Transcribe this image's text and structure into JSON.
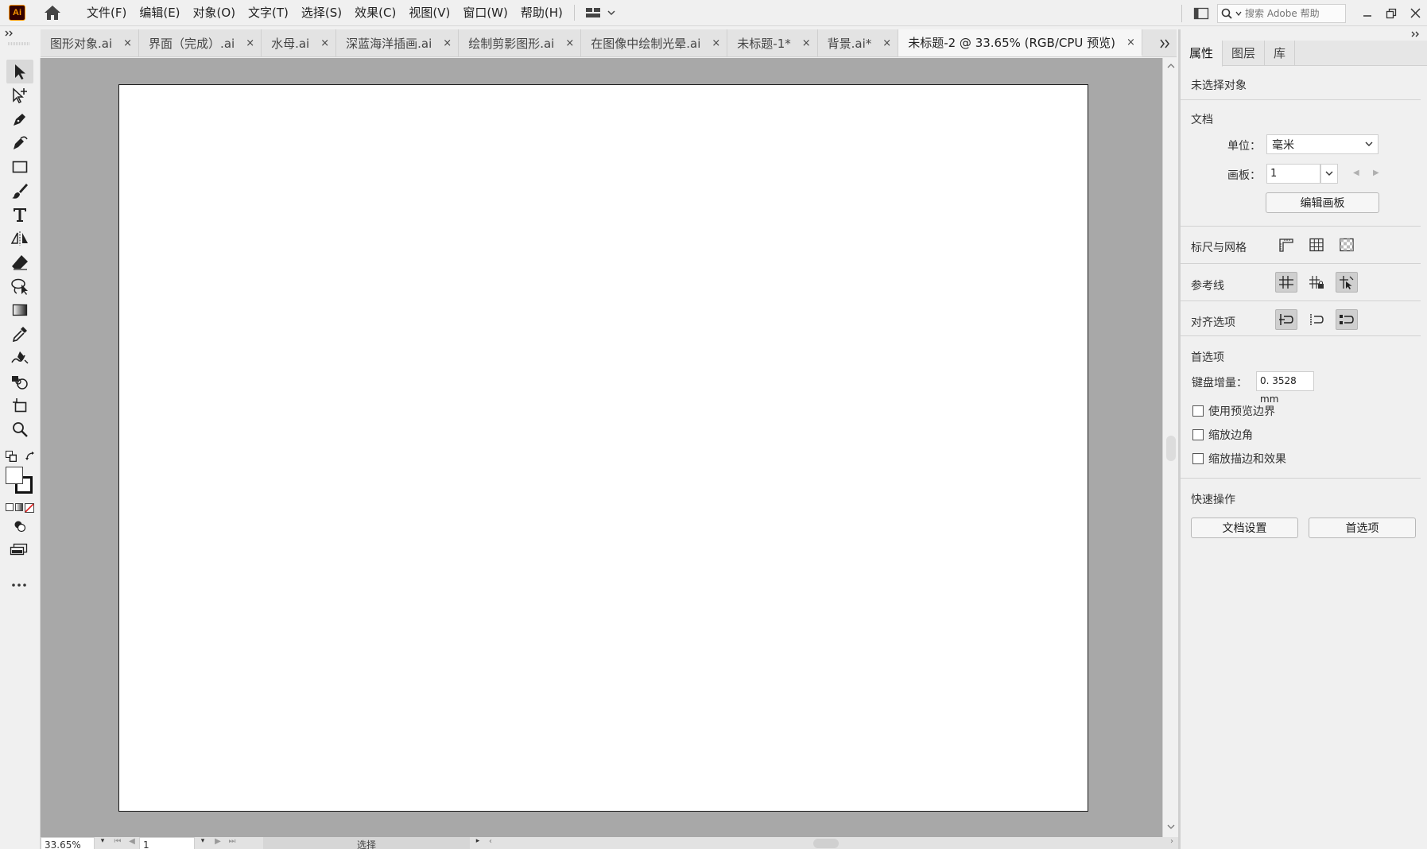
{
  "app": {
    "logo_text": "Ai"
  },
  "menu": [
    "文件(F)",
    "编辑(E)",
    "对象(O)",
    "文字(T)",
    "选择(S)",
    "效果(C)",
    "视图(V)",
    "窗口(W)",
    "帮助(H)"
  ],
  "search": {
    "placeholder": "搜索 Adobe 帮助"
  },
  "tabs": [
    {
      "label": "图形对象.ai",
      "active": false
    },
    {
      "label": "界面（完成）.ai",
      "active": false
    },
    {
      "label": "水母.ai",
      "active": false
    },
    {
      "label": "深蓝海洋插画.ai",
      "active": false
    },
    {
      "label": "绘制剪影图形.ai",
      "active": false
    },
    {
      "label": "在图像中绘制光晕.ai",
      "active": false
    },
    {
      "label": "未标题-1*",
      "active": false
    },
    {
      "label": "背景.ai*",
      "active": false
    },
    {
      "label": "未标题-2 @ 33.65% (RGB/CPU 预览)",
      "active": true
    }
  ],
  "tab_close_glyph": "×",
  "status": {
    "zoom": "33.65%",
    "artboard": "1",
    "current_tool": "选择"
  },
  "panel": {
    "tabs": [
      "属性",
      "图层",
      "库"
    ],
    "no_selection": "未选择对象",
    "document": {
      "title": "文档",
      "units_label": "单位：",
      "units_value": "毫米",
      "artboard_label": "画板：",
      "artboard_value": "1",
      "edit_artboards": "编辑画板"
    },
    "rulers_grids": "标尺与网格",
    "guides": "参考线",
    "snap_options": "对齐选项",
    "preferences": {
      "title": "首选项",
      "keyboard_increment_label": "键盘增量：",
      "keyboard_increment_value": "0. 3528 mm",
      "use_preview_bounds": "使用预览边界",
      "scale_corners": "缩放边角",
      "scale_strokes": "缩放描边和效果"
    },
    "quick_actions": {
      "title": "快速操作",
      "document_setup": "文档设置",
      "preferences": "首选项"
    }
  },
  "colors": {
    "canvas_bg": "#a8a8a8",
    "artboard_bg": "#ffffff",
    "ui_bg": "#f0f0f0",
    "logo_bg": "#330000",
    "logo_fg": "#ff9a00"
  }
}
